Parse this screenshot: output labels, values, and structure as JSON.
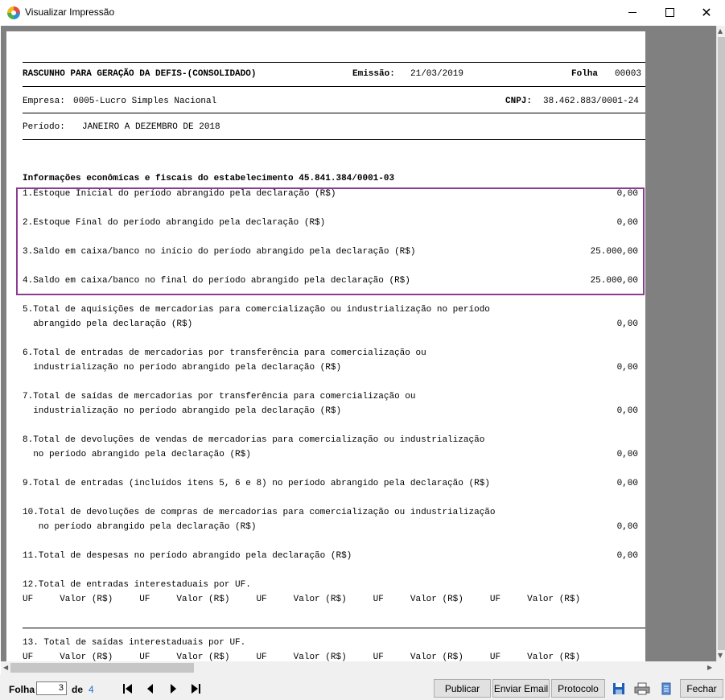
{
  "window": {
    "title": "Visualizar Impressão"
  },
  "report": {
    "heading": "RASCUNHO PARA GERAÇÃO DA DEFIS-(CONSOLIDADO)",
    "emissao_label": "Emissão:",
    "emissao_value": "21/03/2019",
    "folha_label": "Folha",
    "folha_value": "00003",
    "empresa_label": "Empresa:",
    "empresa_value": "0005-Lucro Simples Nacional",
    "cnpj_label": "CNPJ:",
    "cnpj_value": "38.462.883/0001-24",
    "periodo_label": "Período:",
    "periodo_value": "JANEIRO A DEZEMBRO DE 2018",
    "section_title": "Informações econômicas e fiscais do estabelecimento 45.841.384/0001-03",
    "items": [
      {
        "l1": "1.Estoque Inicial do período abrangido pela declaração (R$)",
        "l2": "",
        "value": "0,00"
      },
      {
        "l1": "2.Estoque Final do período abrangido pela declaração (R$)",
        "l2": "",
        "value": "0,00"
      },
      {
        "l1": "3.Saldo em caixa/banco no início do período abrangido pela declaração (R$)",
        "l2": "",
        "value": "25.000,00"
      },
      {
        "l1": "4.Saldo em caixa/banco no final do período abrangido pela declaração (R$)",
        "l2": "",
        "value": "25.000,00"
      },
      {
        "l1": "5.Total de aquisições de mercadorias para comercialização ou industrialização no período",
        "l2": "  abrangido pela declaração (R$)",
        "value": "0,00"
      },
      {
        "l1": "6.Total de entradas de mercadorias por transferência para comercialização ou",
        "l2": "  industrialização no período abrangido pela declaração (R$)",
        "value": "0,00"
      },
      {
        "l1": "7.Total de saídas de mercadorias por transferência para comercialização ou",
        "l2": "  industrialização no período abrangido pela declaração (R$)",
        "value": "0,00"
      },
      {
        "l1": "8.Total de devoluções de vendas de mercadorias para comercialização ou industrialização",
        "l2": "  no período abrangido pela declaração (R$)",
        "value": "0,00"
      },
      {
        "l1": "9.Total de entradas (incluídos itens 5, 6 e 8) no período abrangido pela declaração (R$)",
        "l2": "",
        "value": "0,00"
      },
      {
        "l1": "10.Total de devoluções de compras de mercadorias para comercialização ou industrialização",
        "l2": "   no período abrangido pela declaração (R$)",
        "value": "0,00"
      },
      {
        "l1": "11.Total de despesas no período abrangido pela declaração (R$)",
        "l2": "",
        "value": "0,00"
      }
    ],
    "item12_title": "12.Total de entradas interestaduais por UF.",
    "uf_header": "UF     Valor (R$)     UF     Valor (R$)     UF     Valor (R$)     UF     Valor (R$)     UF     Valor (R$)",
    "item13_title": "13. Total de saídas interestaduais por UF."
  },
  "toolbar": {
    "folha_label": "Folha",
    "page_value": "3",
    "de_label": "de",
    "total_pages": "4",
    "publicar": "Publicar",
    "enviar_email": "Enviar Email",
    "protocolo": "Protocolo",
    "fechar": "Fechar"
  },
  "colors": {
    "highlight": "#8b3d92",
    "total_pages": "#1e6fc8",
    "preview_background": "#808080"
  },
  "icons": [
    "app-logo-icon",
    "first-page-icon",
    "prev-page-icon",
    "next-page-icon",
    "last-page-icon",
    "save-icon",
    "print-icon",
    "document-icon"
  ]
}
